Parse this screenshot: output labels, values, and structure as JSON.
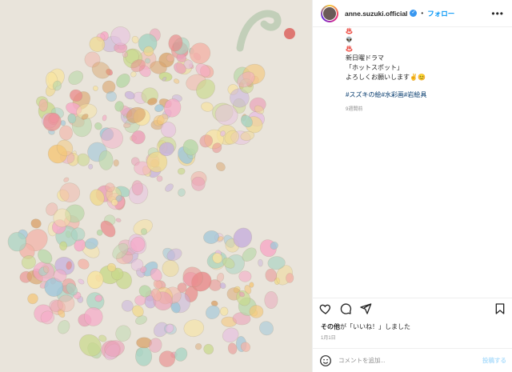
{
  "account": {
    "username": "anne.suzuki.official",
    "follow_label": "フォロー",
    "more_label": "•••"
  },
  "caption": {
    "lines": [
      "新日曜ドラマ",
      "「ホットスポット」",
      "",
      "よろしくお願いします✌😊"
    ],
    "hashtags": "#スズキの絵#水彩画#岩絵具",
    "time_ago": "9週間前"
  },
  "actions": {
    "icons": [
      "heart-icon",
      "comment-icon",
      "share-icon",
      "bookmark-icon"
    ]
  },
  "likes": {
    "name": "その他",
    "text": "が「いいね！」しました"
  },
  "date": "1月1日",
  "comment": {
    "placeholder": "コメントを追加...",
    "post_label": "投稿する"
  },
  "colors": {
    "accent": "#0095f6",
    "link": "#00376b",
    "muted": "#8e8e8e",
    "canvas": "#e9e4db"
  }
}
